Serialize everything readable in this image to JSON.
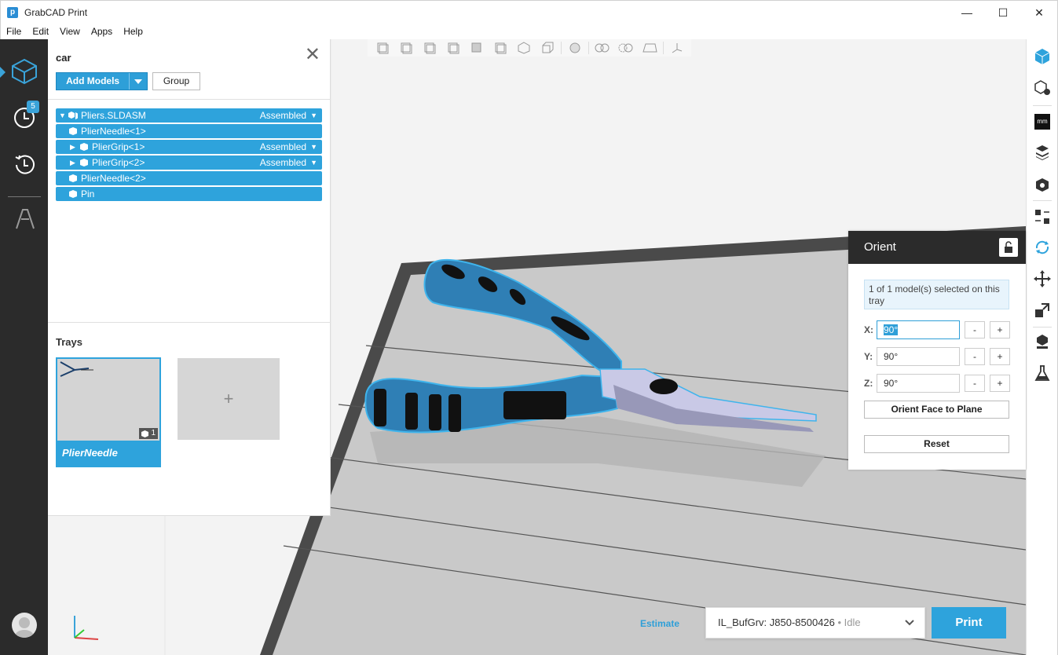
{
  "window": {
    "title": "GrabCAD Print",
    "app_icon": "p",
    "controls": {
      "minimize": "—",
      "maximize": "☐",
      "close": "✕"
    }
  },
  "menu": [
    "File",
    "Edit",
    "View",
    "Apps",
    "Help"
  ],
  "left_rail": {
    "items": [
      {
        "name": "model-view-icon",
        "active": true
      },
      {
        "name": "queue-clock-icon",
        "badge": "5"
      },
      {
        "name": "history-clock-icon"
      },
      {
        "name": "printer-analytics-icon"
      }
    ]
  },
  "panel": {
    "title": "car",
    "close": "✕",
    "add_models_label": "Add Models",
    "group_label": "Group",
    "tree": [
      {
        "label": "Pliers.SLDASM",
        "status": "Assembled",
        "expanded": true,
        "level": 0
      },
      {
        "label": "PlierNeedle<1>",
        "status": "",
        "level": 1
      },
      {
        "label": "PlierGrip<1>",
        "status": "Assembled",
        "expanded": false,
        "level": 1
      },
      {
        "label": "PlierGrip<2>",
        "status": "Assembled",
        "expanded": false,
        "level": 1
      },
      {
        "label": "PlierNeedle<2>",
        "status": "",
        "level": 1
      },
      {
        "label": "Pin",
        "status": "",
        "level": 1
      }
    ],
    "trays_label": "Trays",
    "trays": [
      {
        "name": "PlierNeedle",
        "count": "1",
        "selected": true
      }
    ],
    "add_tray": "+"
  },
  "orient": {
    "title": "Orient",
    "info": "1 of 1 model(s) selected on this tray",
    "x_label": "X:",
    "x_value": "90°",
    "y_label": "Y:",
    "y_value": "90°",
    "z_label": "Z:",
    "z_value": "90°",
    "minus": "-",
    "plus": "+",
    "face_to_plane": "Orient Face to Plane",
    "reset": "Reset"
  },
  "right_rail": {
    "unit_label": "mm"
  },
  "bottom": {
    "estimate": "Estimate",
    "printer_name": "IL_BufGrv: J850-8500426",
    "printer_sep": " • ",
    "printer_status": "Idle",
    "print": "Print"
  },
  "colors": {
    "accent": "#2ea3dc",
    "rail_dark": "#2b2b2b",
    "model_blue": "#2f7fb5"
  }
}
